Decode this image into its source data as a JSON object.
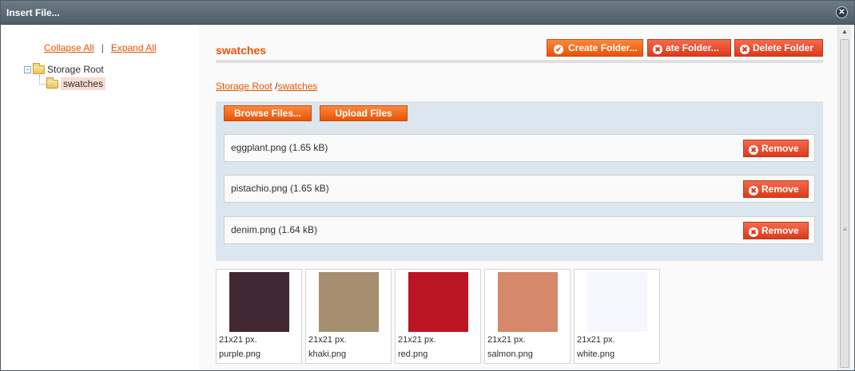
{
  "window": {
    "title": "Insert File...",
    "close_glyph": "✕"
  },
  "tree": {
    "collapse_all": "Collapse All",
    "separator": "|",
    "expand_all": "Expand All",
    "root_label": "Storage Root",
    "child_label": "swatches",
    "toggle_glyph": "−"
  },
  "content": {
    "title": "swatches",
    "buttons": {
      "create_folder": "Create Folder...",
      "delete_folder_partial": "ate Folder...",
      "delete_folder": "Delete Folder",
      "browse_files": "Browse Files...",
      "upload_files": "Upload Files"
    },
    "icons": {
      "check": "✔",
      "cancel": "✖"
    },
    "breadcrumb": {
      "root": "Storage Root",
      "sep": "/",
      "current": "swatches"
    },
    "queue": [
      {
        "name": "eggplant.png (1.65 kB)",
        "remove": "Remove"
      },
      {
        "name": "pistachio.png (1.65 kB)",
        "remove": "Remove"
      },
      {
        "name": "denim.png (1.64 kB)",
        "remove": "Remove"
      }
    ],
    "thumbnails": [
      {
        "dims": "21x21 px.",
        "name": "purple.png",
        "color": "#412832"
      },
      {
        "dims": "21x21 px.",
        "name": "khaki.png",
        "color": "#a68f6f"
      },
      {
        "dims": "21x21 px.",
        "name": "red.png",
        "color": "#bc1624"
      },
      {
        "dims": "21x21 px.",
        "name": "salmon.png",
        "color": "#d5896a"
      },
      {
        "dims": "21x21 px.",
        "name": "white.png",
        "color": "#f7f7ff"
      }
    ]
  },
  "scrollbar": {
    "up_glyph": "▲",
    "down_glyph": "▼",
    "grip_glyph": "≡"
  },
  "colors": {
    "accent": "#eb5202",
    "panel": "#dce6ee",
    "danger": "#dd3a1a"
  }
}
